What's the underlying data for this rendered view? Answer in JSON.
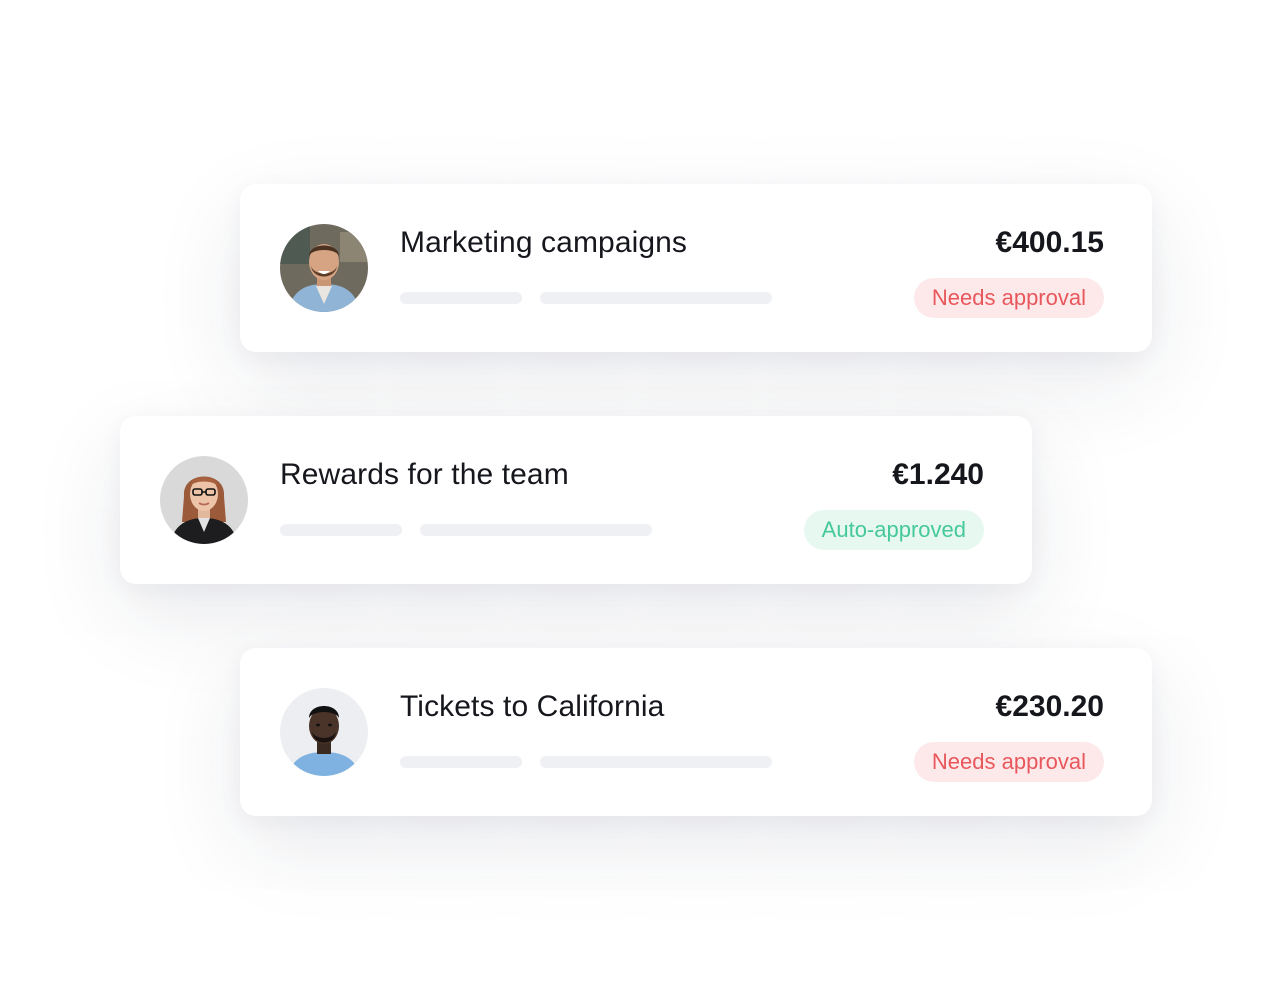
{
  "expenses": [
    {
      "title": "Marketing campaigns",
      "amount": "€400.15",
      "status": "Needs approval",
      "status_type": "needs",
      "avatar": "man-smiling-avatar"
    },
    {
      "title": "Rewards for the team",
      "amount": "€1.240",
      "status": "Auto-approved",
      "status_type": "auto",
      "avatar": "woman-glasses-avatar"
    },
    {
      "title": "Tickets to California",
      "amount": "€230.20",
      "status": "Needs approval",
      "status_type": "needs",
      "avatar": "man-portrait-avatar"
    }
  ],
  "colors": {
    "needs_bg": "#fde9ea",
    "needs_text": "#e8575c",
    "auto_bg": "#e7f8f1",
    "auto_text": "#45c99a",
    "placeholder": "#eef0f3"
  }
}
